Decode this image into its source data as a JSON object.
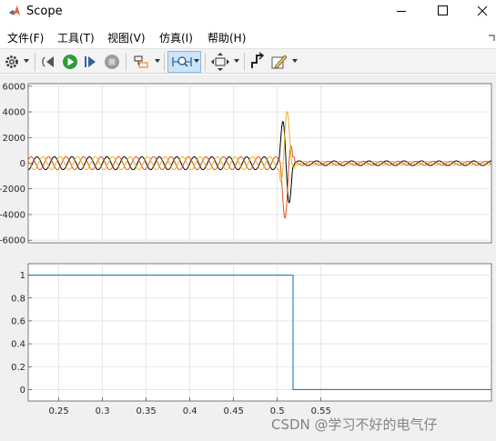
{
  "window": {
    "title": "Scope"
  },
  "menu": [
    {
      "label": "文件(F)"
    },
    {
      "label": "工具(T)"
    },
    {
      "label": "视图(V)"
    },
    {
      "label": "仿真(I)"
    },
    {
      "label": "帮助(H)"
    }
  ],
  "toolbar": {
    "buttons": [
      {
        "icon": "gear-icon"
      },
      {
        "icon": "step-back-icon"
      },
      {
        "icon": "run-icon"
      },
      {
        "icon": "step-forward-icon"
      },
      {
        "icon": "stop-icon"
      },
      {
        "icon": "highlight-icon"
      },
      {
        "icon": "zoom-icon"
      },
      {
        "icon": "fit-icon"
      },
      {
        "icon": "trigger-icon"
      },
      {
        "icon": "edit-icon"
      }
    ]
  },
  "colors": {
    "series_black": "#000000",
    "series_orange": "#d95319",
    "series_yellow": "#edb120",
    "series_blue": "#0072bd",
    "axes_bg": "#ffffff",
    "grid": "#e0e0e0"
  },
  "chart_data": [
    {
      "type": "line",
      "title": "",
      "xlabel": "",
      "ylabel": "",
      "xlim": [
        0.215,
        0.745
      ],
      "ylim": [
        -6200,
        6200
      ],
      "yticks": [
        6000,
        4000,
        2000,
        0,
        -2000,
        -4000,
        -6000
      ],
      "tick_labels": [
        "6000",
        "4000",
        "2000",
        "0",
        "-2000",
        "-4000",
        "-6000"
      ],
      "grid": true,
      "series": [
        {
          "color": "#000000",
          "phase_deg": 0,
          "pre_amplitude": 500,
          "fault_time": 0.502,
          "clear_time": 0.52,
          "peak": 4500,
          "post_amplitude": 180
        },
        {
          "color": "#d95319",
          "phase_deg": 120,
          "pre_amplitude": 500,
          "fault_time": 0.502,
          "clear_time": 0.52,
          "peak": 4400,
          "post_amplitude": 150
        },
        {
          "color": "#edb120",
          "phase_deg": 240,
          "pre_amplitude": 500,
          "fault_time": 0.502,
          "clear_time": 0.52,
          "peak": 4200,
          "post_amplitude": 140
        }
      ],
      "frequency_hz": 50
    },
    {
      "type": "line",
      "title": "",
      "xlabel": "",
      "ylabel": "",
      "xlim": [
        0.215,
        0.745
      ],
      "ylim": [
        -0.1,
        1.1
      ],
      "yticks": [
        1,
        0.8,
        0.6,
        0.4,
        0.2,
        0
      ],
      "tick_labels": [
        "1",
        "0.8",
        "0.6",
        "0.4",
        "0.2",
        "0"
      ],
      "xticks": [
        0.25,
        0.3,
        0.35,
        0.4,
        0.45,
        0.5,
        0.55
      ],
      "x_tick_labels": [
        "0.25",
        "0.3",
        "0.35",
        "0.4",
        "0.45",
        "0.5",
        "0.55"
      ],
      "grid": true,
      "series": [
        {
          "color": "#0072bd",
          "x": [
            0.215,
            0.518,
            0.518,
            0.745
          ],
          "y": [
            1,
            1,
            0,
            0
          ]
        }
      ]
    }
  ],
  "watermark": "CSDN @学习不好的电气仔"
}
